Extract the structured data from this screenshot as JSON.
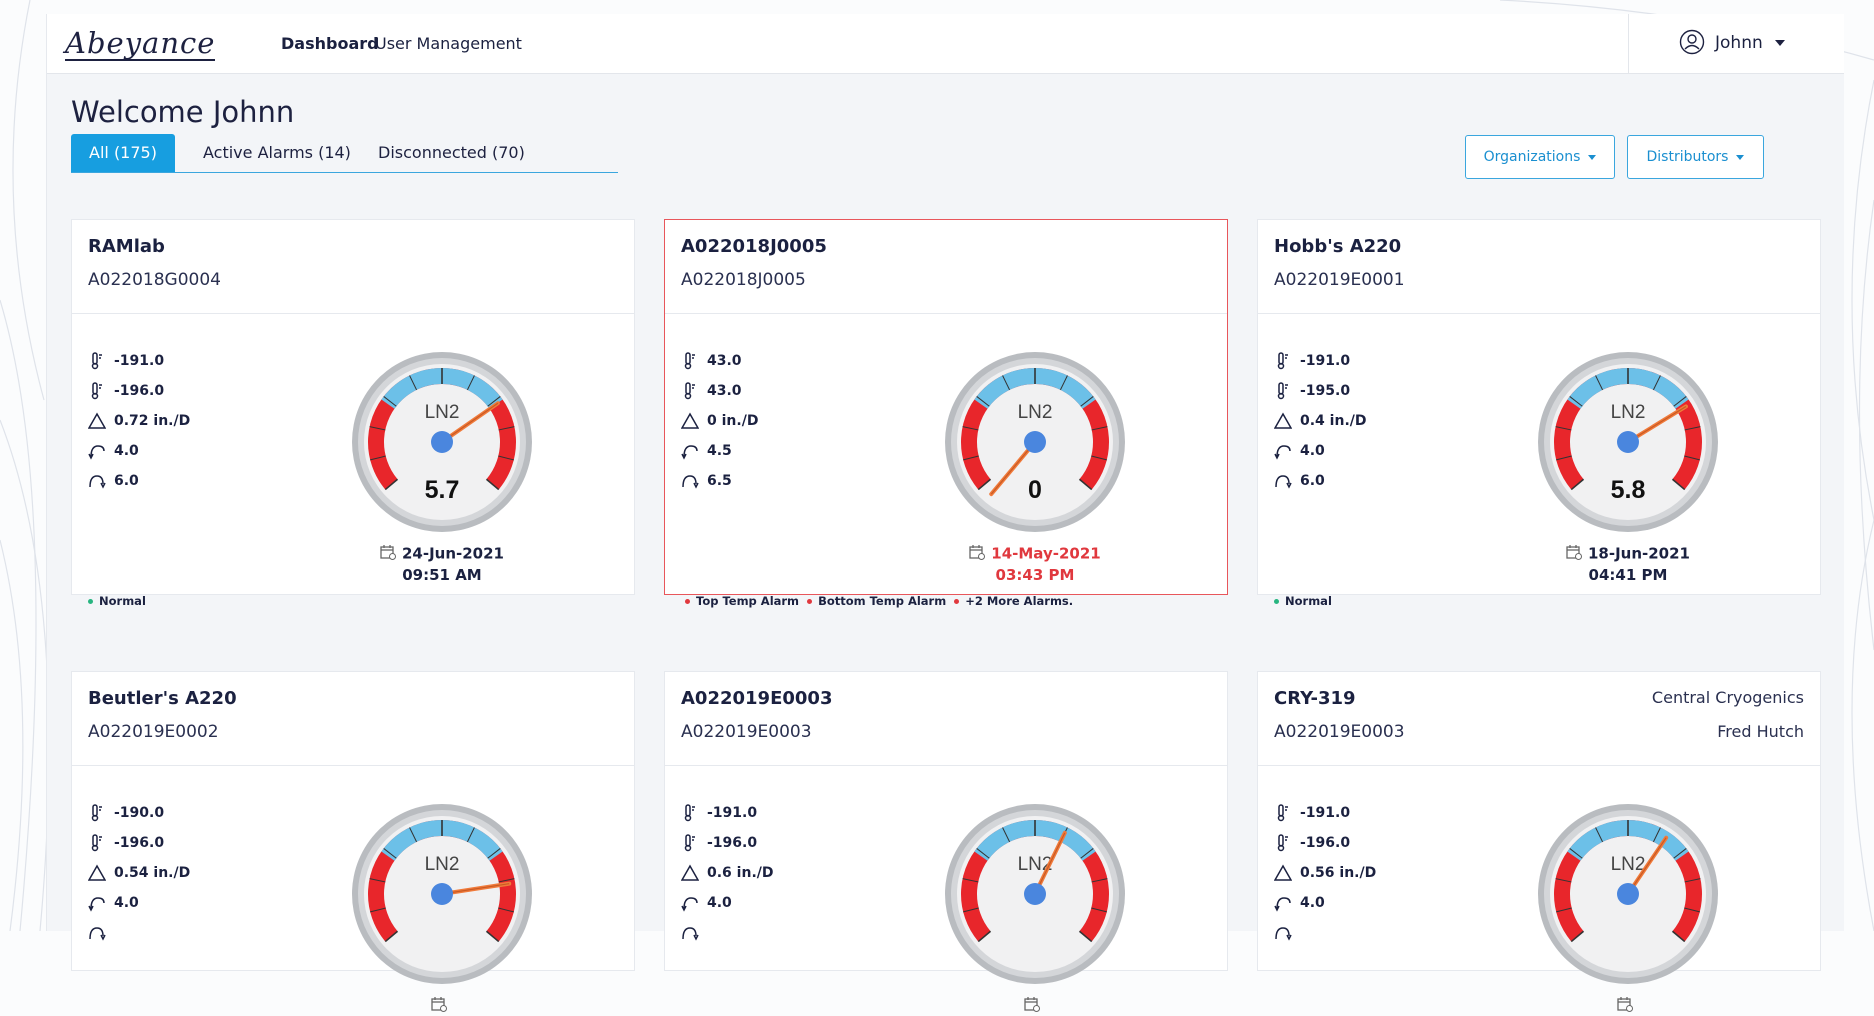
{
  "logo": "Abeyance",
  "nav": [
    {
      "label": "Dashboard",
      "active": true
    },
    {
      "label": "User Management",
      "active": false
    }
  ],
  "user": {
    "name": "Johnn"
  },
  "welcome": "Welcome Johnn",
  "tabs": [
    {
      "label": "All (175)",
      "active": true
    },
    {
      "label": "Active Alarms (14)",
      "active": false
    },
    {
      "label": "Disconnected (70)",
      "active": false
    }
  ],
  "filters": {
    "organizations": "Organizations",
    "distributors": "Distributors"
  },
  "colors": {
    "accent": "#179ee0",
    "alarm": "#e0383e",
    "normal": "#27b580",
    "gauge_red": "#e8262b",
    "gauge_blue": "#6cc0e8",
    "needle": "#f07a3a"
  },
  "devices": [
    {
      "name": "RAMlab",
      "serial": "A022018G0004",
      "organization": "",
      "distributor": "",
      "top_temp": "-191.0",
      "bottom_temp": "-196.0",
      "rate": "0.72 in./D",
      "low": "4.0",
      "high": "6.0",
      "gauge_label": "LN2",
      "level": 5.7,
      "level_text": "5.7",
      "date": "24-Jun-2021",
      "time": "09:51 AM",
      "alarm": false,
      "statuses": [
        "Normal"
      ]
    },
    {
      "name": "A022018J0005",
      "serial": "A022018J0005",
      "organization": "",
      "distributor": "",
      "top_temp": "43.0",
      "bottom_temp": "43.0",
      "rate": "0 in./D",
      "low": "4.5",
      "high": "6.5",
      "gauge_label": "LN2",
      "level": 0,
      "level_text": "0",
      "date": "14-May-2021",
      "time": "03:43 PM",
      "alarm": true,
      "statuses": [
        "Top Temp Alarm",
        "Bottom Temp Alarm",
        "+2 More Alarms."
      ]
    },
    {
      "name": "Hobb's A220",
      "serial": "A022019E0001",
      "organization": "",
      "distributor": "",
      "top_temp": "-191.0",
      "bottom_temp": "-195.0",
      "rate": "0.4 in./D",
      "low": "4.0",
      "high": "6.0",
      "gauge_label": "LN2",
      "level": 5.8,
      "level_text": "5.8",
      "date": "18-Jun-2021",
      "time": "04:41 PM",
      "alarm": false,
      "statuses": [
        "Normal"
      ]
    },
    {
      "name": "Beutler's A220",
      "serial": "A022019E0002",
      "organization": "",
      "distributor": "",
      "top_temp": "-190.0",
      "bottom_temp": "-196.0",
      "rate": "0.54 in./D",
      "low": "4.0",
      "high": "",
      "gauge_label": "LN2",
      "level": 6.5,
      "level_text": "",
      "date": "",
      "time": "",
      "alarm": false,
      "statuses": []
    },
    {
      "name": "A022019E0003",
      "serial": "A022019E0003",
      "organization": "",
      "distributor": "",
      "top_temp": "-191.0",
      "bottom_temp": "-196.0",
      "rate": "0.6 in./D",
      "low": "4.0",
      "high": "",
      "gauge_label": "LN2",
      "level": 4.8,
      "level_text": "",
      "date": "",
      "time": "",
      "alarm": false,
      "statuses": []
    },
    {
      "name": "CRY-319",
      "serial": "A022019E0003",
      "organization": "Central Cryogenics",
      "distributor": "Fred Hutch",
      "top_temp": "-191.0",
      "bottom_temp": "-196.0",
      "rate": "0.56 in./D",
      "low": "4.0",
      "high": "",
      "gauge_label": "LN2",
      "level": 5.05,
      "level_text": "",
      "date": "",
      "time": "",
      "alarm": false,
      "statuses": []
    }
  ]
}
